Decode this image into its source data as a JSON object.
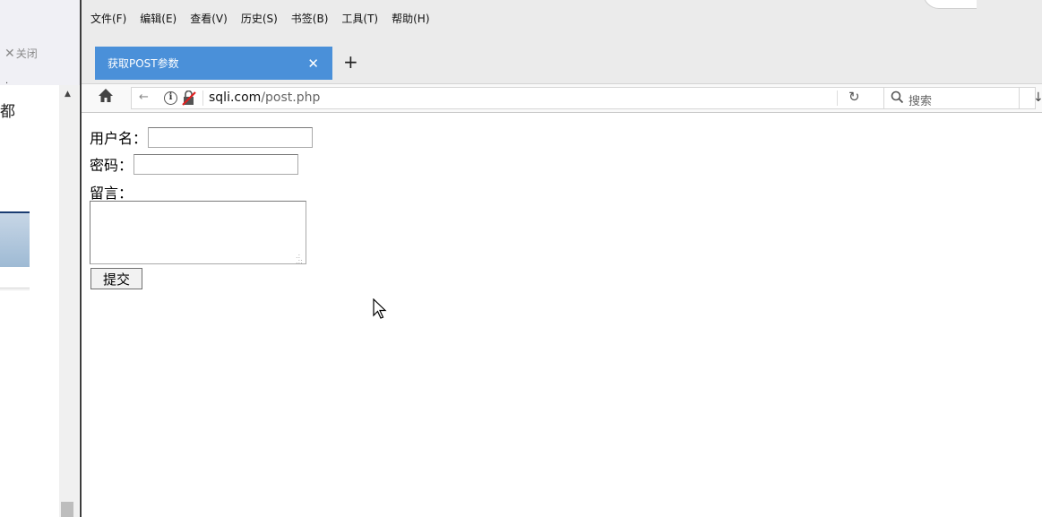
{
  "left_panel": {
    "close_label": "关闭",
    "close_icon": "close-icon",
    "dot_text": "·",
    "partial_char": "都"
  },
  "menubar": {
    "items": [
      "文件(F)",
      "编辑(E)",
      "查看(V)",
      "历史(S)",
      "书签(B)",
      "工具(T)",
      "帮助(H)"
    ]
  },
  "tabs": {
    "active_title": "获取POST参数",
    "close_symbol": "✕",
    "new_tab_symbol": "+"
  },
  "toolbar": {
    "url_host": "sqli.com",
    "url_path": "/post.php",
    "search_placeholder": "搜索",
    "reload_symbol": "↻",
    "back_symbol": "←",
    "download_symbol": "↓",
    "info_symbol": "i"
  },
  "form": {
    "username_label": "用户名：",
    "username_value": "",
    "password_label": "密码：",
    "password_value": "",
    "message_label": "留言：",
    "message_value": "",
    "submit_label": "提交"
  },
  "colors": {
    "active_tab": "#4a90d9",
    "chrome_bg": "#ebebeb",
    "toolbar_bg": "#f9f9f9"
  }
}
